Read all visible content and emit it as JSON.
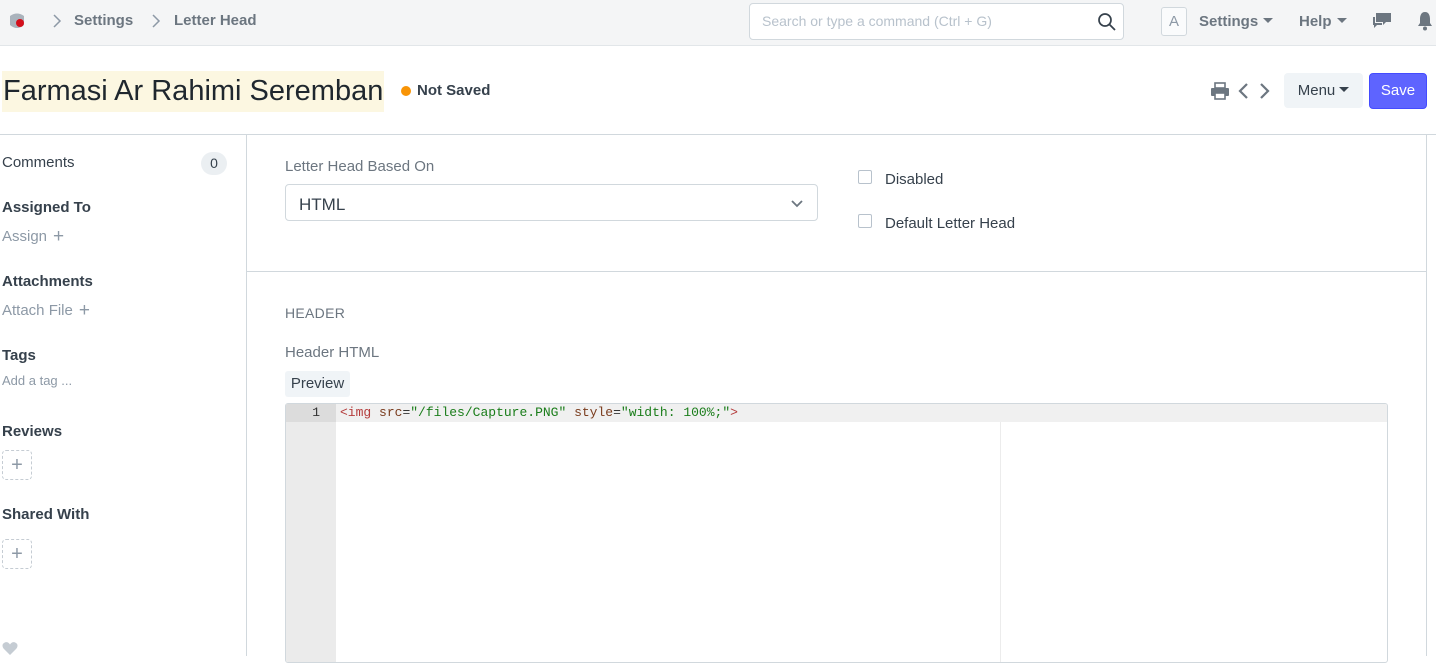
{
  "breadcrumbs": [
    "Settings",
    "Letter Head"
  ],
  "search": {
    "placeholder": "Search or type a command (Ctrl + G)"
  },
  "navbar": {
    "avatar_initial": "A",
    "settings_label": "Settings",
    "help_label": "Help",
    "icons": [
      "app-logo-icon",
      "search-icon",
      "chat-icon",
      "bell-icon"
    ]
  },
  "page": {
    "title": "Farmasi Ar Rahimi Seremban",
    "status": "Not Saved",
    "status_color": "#f89406",
    "menu_label": "Menu",
    "save_label": "Save",
    "accent_color": "#5e64ff",
    "icons": [
      "print-icon",
      "prev-icon",
      "next-icon"
    ]
  },
  "sidebar": {
    "comments_label": "Comments",
    "comments_count": "0",
    "assigned_to_label": "Assigned To",
    "assign_label": "Assign",
    "attachments_label": "Attachments",
    "attach_file_label": "Attach File",
    "tags_label": "Tags",
    "add_tag_label": "Add a tag ...",
    "reviews_label": "Reviews",
    "shared_with_label": "Shared With",
    "plus_glyph": "+"
  },
  "form": {
    "based_on_label": "Letter Head Based On",
    "based_on_value": "HTML",
    "disabled_label": "Disabled",
    "disabled_checked": false,
    "default_label": "Default Letter Head",
    "default_checked": false,
    "header_section": "HEADER",
    "header_html_label": "Header HTML",
    "preview_label": "Preview"
  },
  "editor": {
    "line_number": "1",
    "tokens": [
      "<img",
      " src",
      "=",
      "\"/files/Capture.PNG\"",
      " style",
      "=",
      "\"width: 100%;\"",
      ">"
    ]
  }
}
